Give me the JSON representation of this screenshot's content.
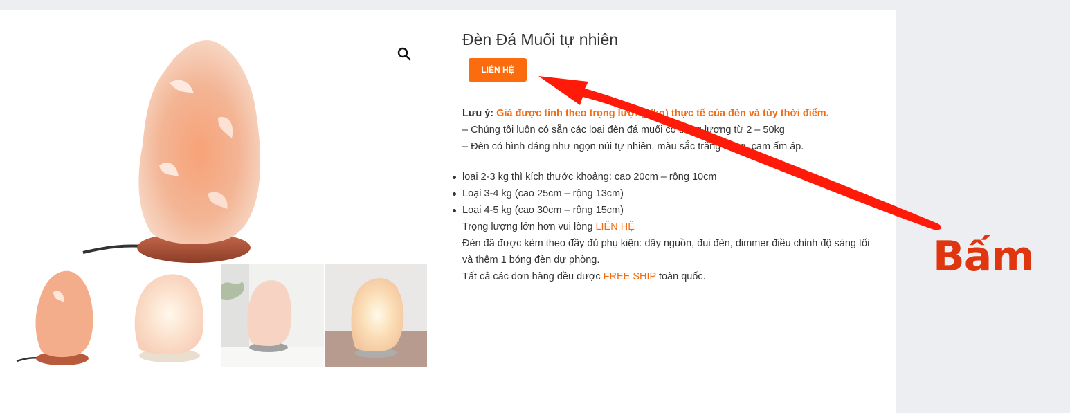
{
  "product": {
    "title": "Đèn Đá Muối tự nhiên",
    "contact_button": "LIÊN HỆ"
  },
  "gallery": {
    "zoom_icon": "search-icon",
    "thumbnails": 4
  },
  "description": {
    "note_label": "Lưu ý:",
    "note_text": "Giá được tính theo trọng lượng (kg) thực tế của đèn và tùy thời điểm.",
    "line1": "– Chúng tôi luôn có sẵn các loại đèn đá muối có trọng lượng từ 2 – 50kg",
    "line2": "– Đèn có hình dáng như ngọn núi tự nhiên, màu sắc trắng hồng, cam ấm áp.",
    "bullets": [
      "loại 2-3 kg thì kích thước khoảng: cao 20cm – rộng 10cm",
      "Loại 3-4 kg (cao 25cm – rộng 13cm)",
      "Loại 4-5 kg (cao 30cm – rộng 15cm)"
    ],
    "heavier_prefix": "Trọng lượng lớn hơn vui lòng ",
    "heavier_link": "LIÊN HỆ",
    "accessories": "Đèn đã được kèm theo đầy đủ phụ kiện: dây nguồn, đui đèn, dimmer điều chỉnh độ sáng tối và thêm 1 bóng đèn dự phòng.",
    "shipping_prefix": "Tất cả các đơn hàng đều được ",
    "shipping_highlight": "FREE SHIP",
    "shipping_suffix": " toàn quốc."
  },
  "annotation": {
    "label": "Bấm",
    "color": "#e0360f"
  },
  "colors": {
    "accent": "#fb6c0f",
    "link": "#f26b10"
  }
}
